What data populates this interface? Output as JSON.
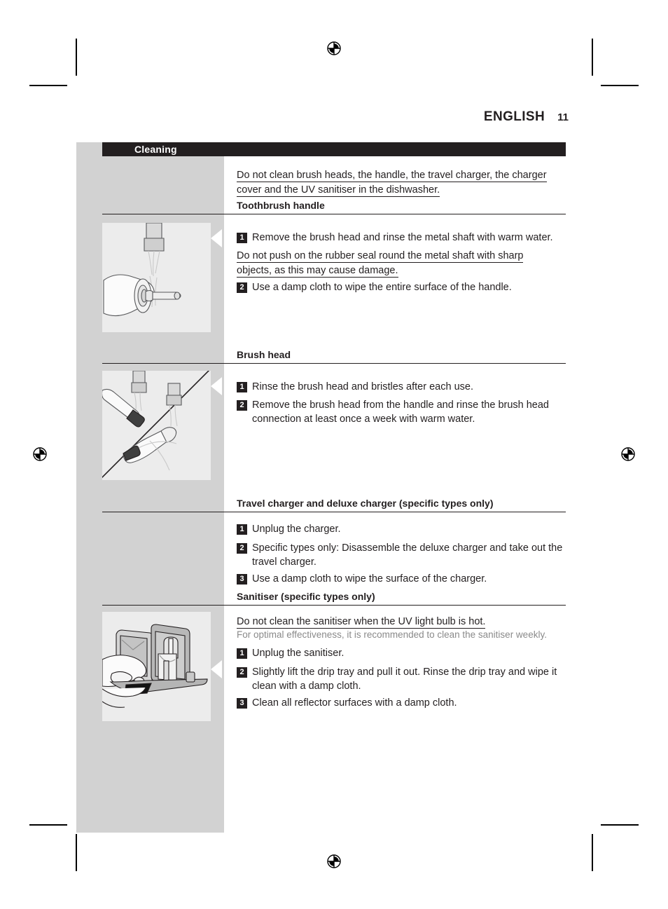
{
  "header": {
    "language": "ENGLISH",
    "page_number": "11"
  },
  "section_bar": {
    "title": "Cleaning"
  },
  "intro_warning": {
    "line1": "Do not clean brush heads, the handle, the travel charger, the charger",
    "line2": "cover and the UV sanitiser in the dishwasher."
  },
  "sections": [
    {
      "heading": "Toothbrush handle",
      "steps": [
        {
          "number": "1",
          "text": "Remove the brush head and rinse the metal shaft with warm water."
        },
        {
          "number": "2",
          "text": "Use a damp cloth to wipe the entire surface of the handle."
        }
      ],
      "warning": {
        "line1": "Do not push on the rubber seal round the metal shaft with sharp",
        "line2": "objects, as this may cause damage."
      },
      "illustration": "toothbrush-handle-rinsing-illustration"
    },
    {
      "heading": "Brush head",
      "steps": [
        {
          "number": "1",
          "text": "Rinse the brush head and bristles after each use."
        },
        {
          "number": "2",
          "text": "Remove the brush head from the handle and rinse the brush head connection at least once a week with warm water."
        }
      ],
      "illustration": "brush-head-rinsing-illustration"
    },
    {
      "heading": "Travel charger and deluxe charger (specific types only)",
      "steps": [
        {
          "number": "1",
          "text": "Unplug the charger."
        },
        {
          "number": "2",
          "text": "Specific types only: Disassemble the deluxe charger and take out the travel charger."
        },
        {
          "number": "3",
          "text": "Use a damp cloth to wipe the surface of the charger."
        }
      ]
    },
    {
      "heading": "Sanitiser (specific types only)",
      "warning": {
        "line1": "Do not clean the sanitiser when the UV light bulb is hot."
      },
      "note": "For optimal effectiveness, it is recommended to clean the sanitiser weekly.",
      "steps": [
        {
          "number": "1",
          "text": "Unplug the sanitiser."
        },
        {
          "number": "2",
          "text": "Slightly lift the drip tray and pull it out. Rinse the drip tray and wipe it clean with a damp cloth."
        },
        {
          "number": "3",
          "text": "Clean all reflector surfaces with a damp cloth."
        }
      ],
      "illustration": "sanitiser-drip-tray-illustration"
    }
  ],
  "colors": {
    "ink": "#231f20",
    "panel_gray": "#d2d2d2",
    "illustration_gray": "#ececec",
    "note_gray": "#8a8a8a"
  }
}
